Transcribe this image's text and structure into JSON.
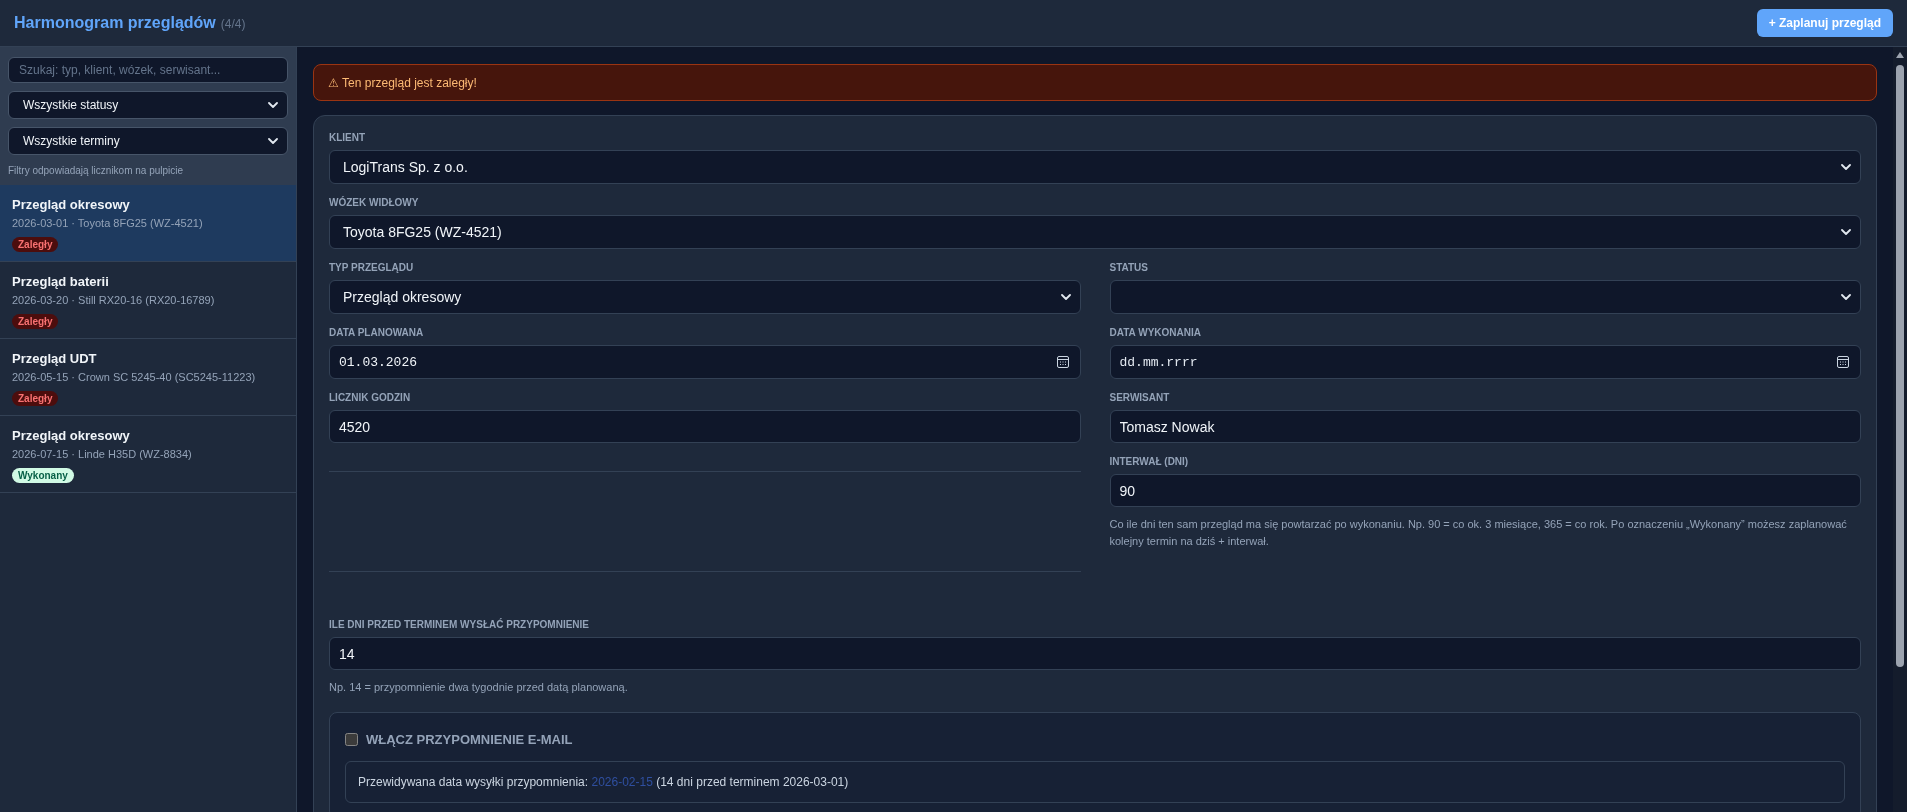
{
  "header": {
    "title": "Harmonogram przeglądów",
    "count": "(4/4)",
    "button": "+ Zaplanuj przegląd"
  },
  "sidebar": {
    "search": {
      "placeholder": "Szukaj: typ, klient, wózek, serwisant..."
    },
    "filters": [
      "Wszystkie statusy",
      "Wszystkie terminy"
    ],
    "hint": "Filtry odpowiadają licznikom na pulpicie",
    "items": [
      {
        "title": "Przegląd okresowy",
        "subtitle": "2026-03-01 · Toyota 8FG25 (WZ-4521)",
        "badge": {
          "text": "Zaległy",
          "kind": "overdue"
        },
        "selected": true
      },
      {
        "title": "Przegląd baterii",
        "subtitle": "2026-03-20 · Still RX20-16 (RX20-16789)",
        "badge": {
          "text": "Zaległy",
          "kind": "overdue"
        },
        "selected": false
      },
      {
        "title": "Przegląd UDT",
        "subtitle": "2026-05-15 · Crown SC 5245-40 (SC5245-11223)",
        "badge": {
          "text": "Zaległy",
          "kind": "overdue"
        },
        "selected": false
      },
      {
        "title": "Przegląd okresowy",
        "subtitle": "2026-07-15 · Linde H35D (WZ-8834)",
        "badge": {
          "text": "Wykonany",
          "kind": "done"
        },
        "selected": false
      }
    ]
  },
  "alert": {
    "text": "⚠ Ten przegląd jest zaległy!"
  },
  "form": {
    "top_fields": [
      {
        "label": "KLIENT",
        "kind": "select",
        "value": "LogiTrans Sp. z o.o."
      },
      {
        "label": "WÓZEK WIDŁOWY",
        "kind": "select",
        "value": "Toyota 8FG25 (WZ-4521)"
      }
    ],
    "left_fields": [
      {
        "label": "TYP PRZEGLĄDU",
        "kind": "select",
        "value": "Przegląd okresowy"
      },
      {
        "label": "DATA PLANOWANA",
        "kind": "date",
        "value": "01.03.2026"
      },
      {
        "label": "LICZNIK GODZIN",
        "kind": "text",
        "value": "4520"
      }
    ],
    "right_fields": [
      {
        "label": "STATUS",
        "kind": "select"
      },
      {
        "label": "DATA WYKONANIA",
        "kind": "date",
        "placeholder": "dd.mm.rrrr"
      },
      {
        "label": "SERWISANT",
        "kind": "text",
        "value": "Tomasz Nowak"
      },
      {
        "label": "INTERWAŁ (DNI)",
        "kind": "text",
        "value": "90",
        "help": "Co ile dni ten sam przegląd ma się powtarzać po wykonaniu. Np. 90 = co ok. 3 miesiące, 365 = co rok. Po oznaczeniu „Wykonany” możesz zaplanować kolejny termin na dziś + interwał."
      }
    ],
    "reminder_days": {
      "label": "ILE DNI PRZED TERMINEM WYSŁAĆ PRZYPOMNIENIE",
      "kind": "text",
      "value": "14",
      "help": "Np. 14 = przypomnienie dwa tygodnie przed datą planowaną."
    },
    "reminder": {
      "label": "WŁĄCZ PRZYPOMNIENIE E-MAIL",
      "checked": false,
      "preview": {
        "text": "Przewidywana data wysyłki przypomnienia:",
        "date": "2026-02-15",
        "note": "(14 dni przed terminem 2026-03-01)"
      }
    }
  }
}
